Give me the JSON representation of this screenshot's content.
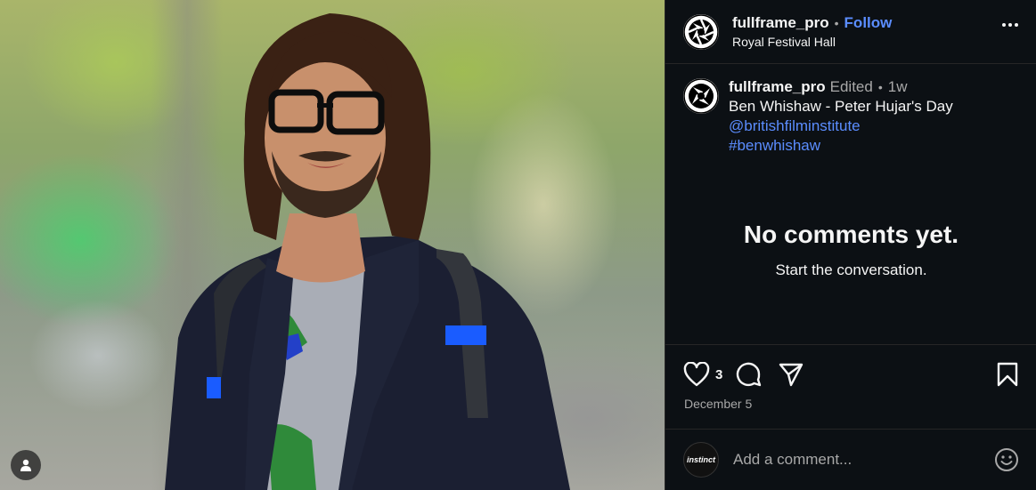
{
  "post": {
    "username": "fullframe_pro",
    "follow_label": "Follow",
    "location": "Royal Festival Hall",
    "more_icon": "more-horizontal-icon"
  },
  "caption": {
    "username": "fullframe_pro",
    "edited": "Edited",
    "time_ago": "1w",
    "text": "Ben Whishaw - Peter Hujar's Day",
    "mention": "@britishfilminstitute",
    "hashtag": "#benwhishaw"
  },
  "comments": {
    "empty_title": "No comments yet.",
    "empty_subtitle": "Start the conversation."
  },
  "actions": {
    "like_count": "3",
    "date": "December 5"
  },
  "composer": {
    "avatar_text": "instinct",
    "placeholder": "Add a comment..."
  },
  "colors": {
    "background": "#0c1014",
    "link": "#5b8dff",
    "muted": "#a8a8a8"
  }
}
